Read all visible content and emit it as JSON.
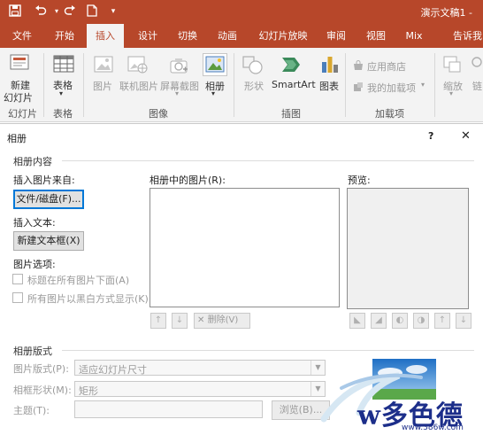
{
  "window": {
    "doc_title": "演示文稿1 -"
  },
  "colors": {
    "accent": "#b7472a",
    "ribbon_bg": "#f3f3f3",
    "focus": "#0078d7"
  },
  "quick_access": [
    {
      "icon": "save-icon"
    },
    {
      "icon": "undo-icon"
    },
    {
      "icon": "redo-icon"
    },
    {
      "icon": "new-document-icon"
    },
    {
      "icon": "customize-dropdown-icon"
    }
  ],
  "tabs": [
    "文件",
    "开始",
    "插入",
    "设计",
    "切换",
    "动画",
    "幻灯片放映",
    "审阅",
    "视图",
    "Mix",
    "告诉我"
  ],
  "active_tab": "插入",
  "ribbon": {
    "new_slide": "新建\n幻灯片",
    "new_slide_line1": "新建",
    "new_slide_line2": "幻灯片",
    "table": "表格",
    "pictures": "图片",
    "online_pictures": "联机图片",
    "screenshot": "屏幕截图",
    "photo_album": "相册",
    "shapes": "形状",
    "smartart": "SmartArt",
    "chart": "图表",
    "store": "应用商店",
    "my_addins": "我的加载项",
    "zoom": "缩放",
    "link": "链",
    "groups": {
      "slides": "幻灯片",
      "tables": "表格",
      "images": "图像",
      "illustrations": "插图",
      "addins": "加载项"
    }
  },
  "dialog": {
    "title": "相册",
    "help": "?",
    "close": "✕",
    "album_content": "相册内容",
    "insert_from": "插入图片来自:",
    "file_disk_button": "文件/磁盘(F)...",
    "insert_text": "插入文本:",
    "new_textbox_button": "新建文本框(X)",
    "picture_options": "图片选项:",
    "captions_option": "标题在所有图片下面(A)",
    "bw_option": "所有图片以黑白方式显示(K)",
    "pictures_in_album": "相册中的图片(R):",
    "preview": "预览:",
    "delete_button": "删除(V)",
    "album_layout": "相册版式",
    "picture_layout_label": "图片版式(P):",
    "picture_layout_value": "适应幻灯片尺寸",
    "frame_shape_label": "相框形状(M):",
    "frame_shape_value": "矩形",
    "theme_label": "主题(T):",
    "browse_button": "浏览(B)..."
  },
  "watermark": {
    "text": "w多色德",
    "url": "www.386w.com"
  }
}
